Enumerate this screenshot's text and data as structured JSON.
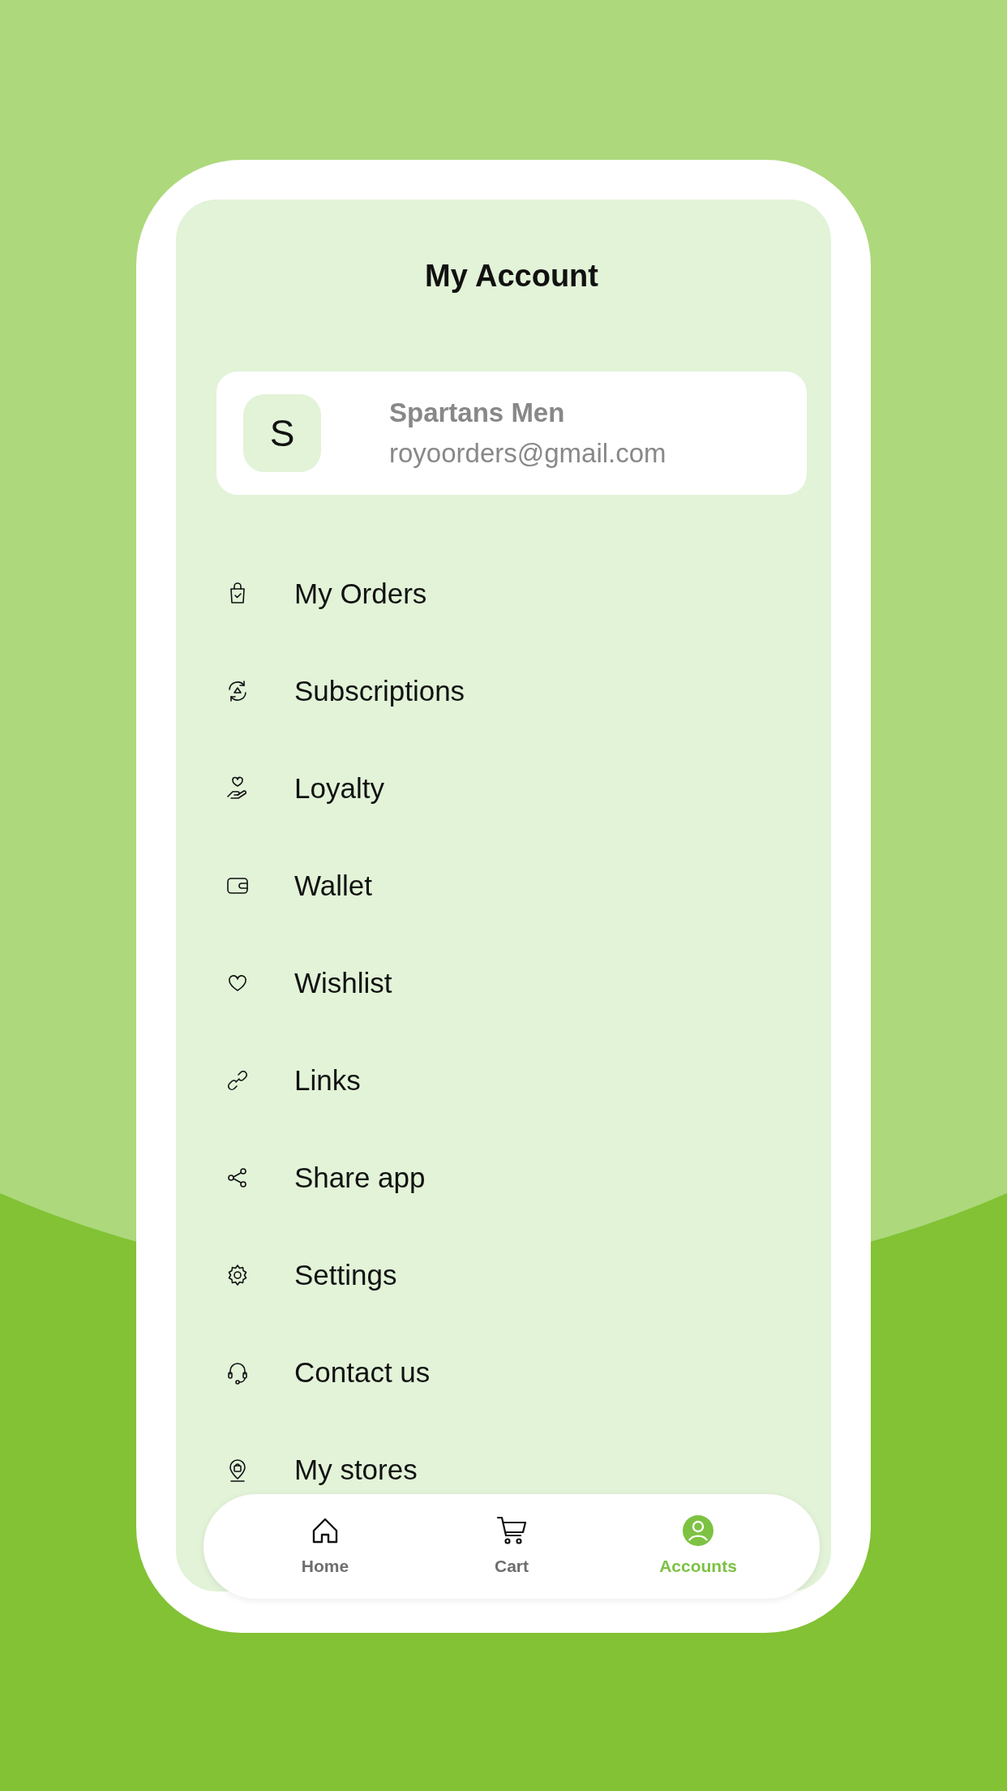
{
  "screen": {
    "title": "My Account"
  },
  "profile": {
    "initial": "S",
    "name": "Spartans Men",
    "email": "royoorders@gmail.com"
  },
  "menu": [
    {
      "label": "My Orders"
    },
    {
      "label": "Subscriptions"
    },
    {
      "label": "Loyalty"
    },
    {
      "label": "Wallet"
    },
    {
      "label": "Wishlist"
    },
    {
      "label": "Links"
    },
    {
      "label": "Share app"
    },
    {
      "label": "Settings"
    },
    {
      "label": "Contact us"
    },
    {
      "label": "My stores"
    }
  ],
  "nav": [
    {
      "label": "Home",
      "selected": false
    },
    {
      "label": "Cart",
      "selected": false
    },
    {
      "label": "Accounts",
      "selected": true
    }
  ]
}
